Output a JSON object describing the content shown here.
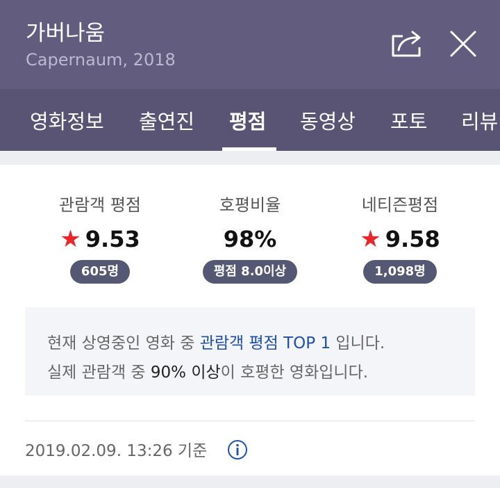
{
  "header": {
    "title": "가버나움",
    "subtitle": "Capernaum, 2018",
    "share_icon": "share-icon",
    "close_icon": "close-icon"
  },
  "tabs": [
    {
      "label": "영화정보",
      "active": false
    },
    {
      "label": "출연진",
      "active": false
    },
    {
      "label": "평점",
      "active": true
    },
    {
      "label": "동영상",
      "active": false
    },
    {
      "label": "포토",
      "active": false
    },
    {
      "label": "리뷰",
      "active": false
    }
  ],
  "ratings": {
    "audience": {
      "label": "관람객 평점",
      "value": "9.53",
      "badge": "605명"
    },
    "favorable": {
      "label": "호평비율",
      "value": "98%",
      "badge": "평점 8.0이상"
    },
    "netizen": {
      "label": "네티즌평점",
      "value": "9.58",
      "badge": "1,098명"
    }
  },
  "notice": {
    "line1_prefix": "현재 상영중인 영화 중 ",
    "line1_highlight": "관람객 평점 TOP 1",
    "line1_suffix": " 입니다.",
    "line2_prefix": "실제 관람객 중 ",
    "line2_highlight": "90% 이상",
    "line2_suffix": "이 호평한 영화입니다."
  },
  "footer": {
    "timestamp": "2019.02.09. 13:26 기준",
    "info_icon": "info-icon"
  },
  "colors": {
    "header_bg": "#625d7e",
    "tabs_bg": "#595473",
    "star": "#e8262c",
    "pill_bg": "#555872",
    "highlight_blue": "#1e4fae"
  }
}
